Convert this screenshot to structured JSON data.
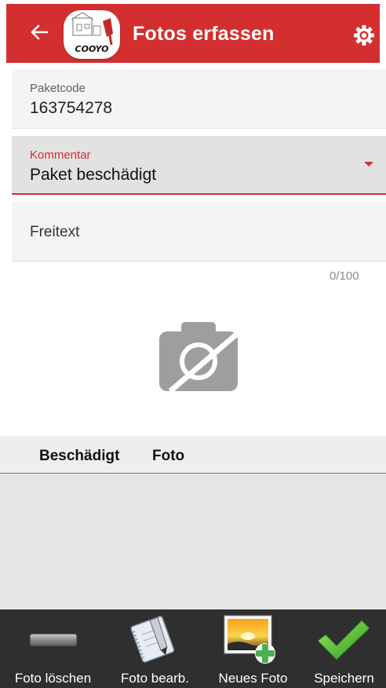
{
  "appbar": {
    "title": "Fotos erfassen",
    "logo_text": "COOYO",
    "back_icon": "arrow-left-icon",
    "settings_icon": "gear-icon",
    "color": "#d32f2f"
  },
  "form": {
    "paketcode": {
      "label": "Paketcode",
      "value": "163754278"
    },
    "kommentar": {
      "label": "Kommentar",
      "value": "Paket beschädigt"
    },
    "freitext": {
      "placeholder": "Freitext",
      "counter": "0/100"
    }
  },
  "photo_placeholder_icon": "no-photo-icon",
  "table": {
    "headers": [
      "Beschädigt",
      "Foto"
    ],
    "rows": []
  },
  "bottom_bar": {
    "items": [
      {
        "label": "Foto löschen",
        "icon": "minus-icon"
      },
      {
        "label": "Foto bearb.",
        "icon": "notebook-pencil-icon"
      },
      {
        "label": "Neues Foto",
        "icon": "add-photo-icon"
      },
      {
        "label": "Speichern",
        "icon": "checkmark-icon"
      }
    ]
  }
}
